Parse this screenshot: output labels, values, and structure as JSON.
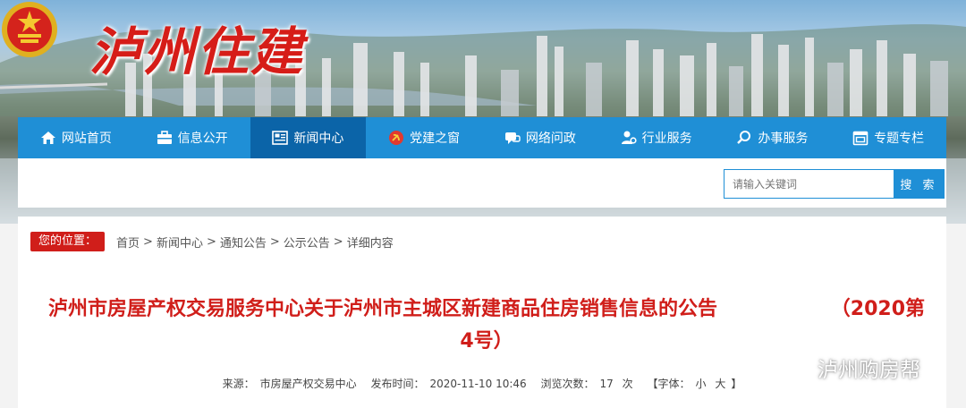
{
  "site": {
    "title": "泸州住建"
  },
  "nav": {
    "items": [
      {
        "label": "网站首页",
        "icon": "home-icon",
        "active": false
      },
      {
        "label": "信息公开",
        "icon": "briefcase-icon",
        "active": false
      },
      {
        "label": "新闻中心",
        "icon": "newspaper-icon",
        "active": true
      },
      {
        "label": "党建之窗",
        "icon": "party-emblem-icon",
        "active": false
      },
      {
        "label": "网络问政",
        "icon": "chat-icon",
        "active": false
      },
      {
        "label": "行业服务",
        "icon": "user-gear-icon",
        "active": false
      },
      {
        "label": "办事服务",
        "icon": "search-icon",
        "active": false
      },
      {
        "label": "专题专栏",
        "icon": "calendar-icon",
        "active": false
      }
    ]
  },
  "search": {
    "placeholder": "请输入关键词",
    "button_label": "搜 索"
  },
  "breadcrumb": {
    "label": "您的位置：",
    "items": [
      "首页",
      "新闻中心",
      "通知公告",
      "公示公告",
      "详细内容"
    ],
    "separator": ">"
  },
  "article": {
    "title_part1": "泸州市房屋产权交易服务中心关于泸州市主城区新建商品住房销售信息的公告",
    "title_part2": "（2020第",
    "title_part3": "4号）",
    "meta": {
      "source_label": "来源：",
      "source": "市房屋产权交易中心",
      "time_label": "发布时间：",
      "time": "2020-11-10 10:46",
      "views_label": "浏览次数：",
      "views": "17",
      "views_unit": "次",
      "font_open": "【字体：",
      "font_small": "小",
      "font_large": "大",
      "font_close": "】"
    }
  },
  "watermark": {
    "text": "泸州购房帮"
  },
  "colors": {
    "nav_bg": "#1f8fd6",
    "nav_active": "#0b64a8",
    "title_red": "#d01e1a",
    "label_red": "#d01e1a"
  }
}
